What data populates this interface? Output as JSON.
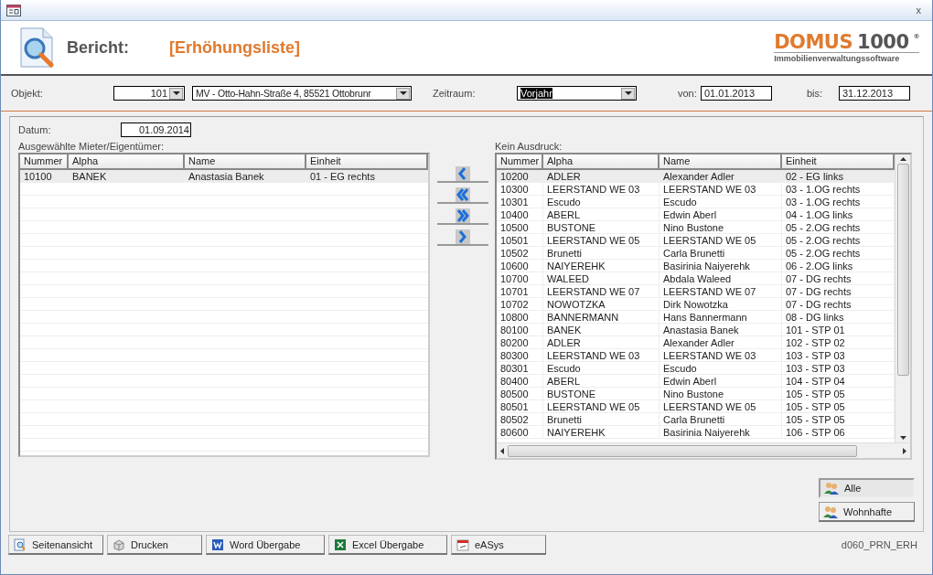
{
  "window": {
    "close": "x"
  },
  "header": {
    "label": "Bericht:",
    "report": "[Erhöhungsliste]",
    "logo_word": "DOMUS",
    "logo_number": "1000",
    "logo_mark": "®",
    "logo_tagline": "Immobilienverwaltungssoftware"
  },
  "filters": {
    "objekt_label": "Objekt:",
    "objekt_number": "101",
    "objekt_address": "MV - Otto-Hahn-Straße 4, 85521 Ottobrunr",
    "zeitraum_label": "Zeitraum:",
    "zeitraum_value": "Vorjahr",
    "zeitraum_highlighted": true,
    "von_label": "von:",
    "von": "01.01.2013",
    "bis_label": "bis:",
    "bis": "31.12.2013"
  },
  "datum": {
    "label": "Datum:",
    "value": "01.09.2014"
  },
  "selected_list": {
    "title": "Ausgewählte Mieter/Eigentümer:",
    "columns": [
      "Nummer",
      "Alpha",
      "Name",
      "Einheit"
    ],
    "rows": [
      {
        "cells": [
          "10100",
          "BANEK",
          "Anastasia Banek",
          "01 - EG rechts"
        ],
        "selected": true
      }
    ]
  },
  "move_buttons": [
    {
      "kind": "left"
    },
    {
      "kind": "all-left"
    },
    {
      "kind": "all-right"
    },
    {
      "kind": "right"
    }
  ],
  "excluded_list": {
    "title": "Kein Ausdruck:",
    "columns": [
      "Nummer",
      "Alpha",
      "Name",
      "Einheit"
    ],
    "rows": [
      {
        "cells": [
          "10200",
          "ADLER",
          "Alexander Adler",
          "02 - EG links"
        ],
        "selected": true
      },
      {
        "cells": [
          "10300",
          "LEERSTAND WE 03",
          "LEERSTAND WE 03",
          "03 - 1.OG rechts"
        ],
        "selected": false
      },
      {
        "cells": [
          "10301",
          "Escudo",
          "Escudo",
          "03 - 1.OG rechts"
        ],
        "selected": false
      },
      {
        "cells": [
          "10400",
          "ABERL",
          "Edwin Aberl",
          "04 - 1.OG links"
        ],
        "selected": false
      },
      {
        "cells": [
          "10500",
          "BUSTONE",
          "Nino Bustone",
          "05 - 2.OG rechts"
        ],
        "selected": false
      },
      {
        "cells": [
          "10501",
          "LEERSTAND WE 05",
          "LEERSTAND WE 05",
          "05 - 2.OG rechts"
        ],
        "selected": false
      },
      {
        "cells": [
          "10502",
          "Brunetti",
          "Carla Brunetti",
          "05 - 2.OG rechts"
        ],
        "selected": false
      },
      {
        "cells": [
          "10600",
          "NAIYEREHK",
          "Basirinia Naiyerehk",
          "06 - 2.OG links"
        ],
        "selected": false
      },
      {
        "cells": [
          "10700",
          "WALEED",
          "Abdala Waleed",
          "07 - DG rechts"
        ],
        "selected": false
      },
      {
        "cells": [
          "10701",
          "LEERSTAND WE 07",
          "LEERSTAND WE 07",
          "07 - DG rechts"
        ],
        "selected": false
      },
      {
        "cells": [
          "10702",
          "NOWOTZKA",
          "Dirk Nowotzka",
          "07 - DG rechts"
        ],
        "selected": false
      },
      {
        "cells": [
          "10800",
          "BANNERMANN",
          "Hans Bannermann",
          "08 - DG links"
        ],
        "selected": false
      },
      {
        "cells": [
          "80100",
          "BANEK",
          "Anastasia Banek",
          "101 - STP 01"
        ],
        "selected": false
      },
      {
        "cells": [
          "80200",
          "ADLER",
          "Alexander Adler",
          "102 - STP 02"
        ],
        "selected": false
      },
      {
        "cells": [
          "80300",
          "LEERSTAND WE 03",
          "LEERSTAND WE 03",
          "103 - STP 03"
        ],
        "selected": false
      },
      {
        "cells": [
          "80301",
          "Escudo",
          "Escudo",
          "103 - STP 03"
        ],
        "selected": false
      },
      {
        "cells": [
          "80400",
          "ABERL",
          "Edwin Aberl",
          "104 - STP 04"
        ],
        "selected": false
      },
      {
        "cells": [
          "80500",
          "BUSTONE",
          "Nino Bustone",
          "105 - STP 05"
        ],
        "selected": false
      },
      {
        "cells": [
          "80501",
          "LEERSTAND WE 05",
          "LEERSTAND WE 05",
          "105 - STP 05"
        ],
        "selected": false
      },
      {
        "cells": [
          "80502",
          "Brunetti",
          "Carla Brunetti",
          "105 - STP 05"
        ],
        "selected": false
      },
      {
        "cells": [
          "80600",
          "NAIYEREHK",
          "Basirinia Naiyerehk",
          "106 - STP 06"
        ],
        "selected": false
      }
    ]
  },
  "filter_buttons": [
    {
      "label": "Alle",
      "selected": true
    },
    {
      "label": "Wohnhafte",
      "selected": false
    }
  ],
  "toolbar": [
    {
      "label": "Seitenansicht",
      "kind": "preview"
    },
    {
      "label": "Drucken",
      "kind": "print"
    },
    {
      "label": "Word Übergabe",
      "kind": "word"
    },
    {
      "label": "Excel Übergabe",
      "kind": "excel"
    },
    {
      "label": "eASys",
      "kind": "easys"
    }
  ],
  "form_id": "d060_PRN_ERH"
}
